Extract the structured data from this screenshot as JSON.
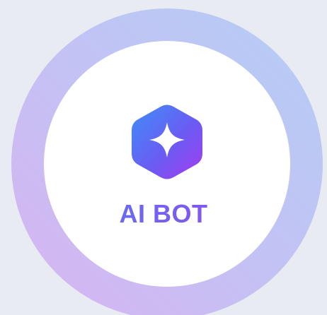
{
  "badge": {
    "title": "AI BOT",
    "icon": "sparkle-hexagon-icon"
  },
  "colors": {
    "background": "#e9ebf3",
    "ring_start": "#b4cbf6",
    "ring_end": "#d5b4f2",
    "inner": "#ffffff",
    "accent_blue": "#4a86f7",
    "accent_purple": "#a24cf0",
    "dashed_line": "#6d6bf0"
  }
}
